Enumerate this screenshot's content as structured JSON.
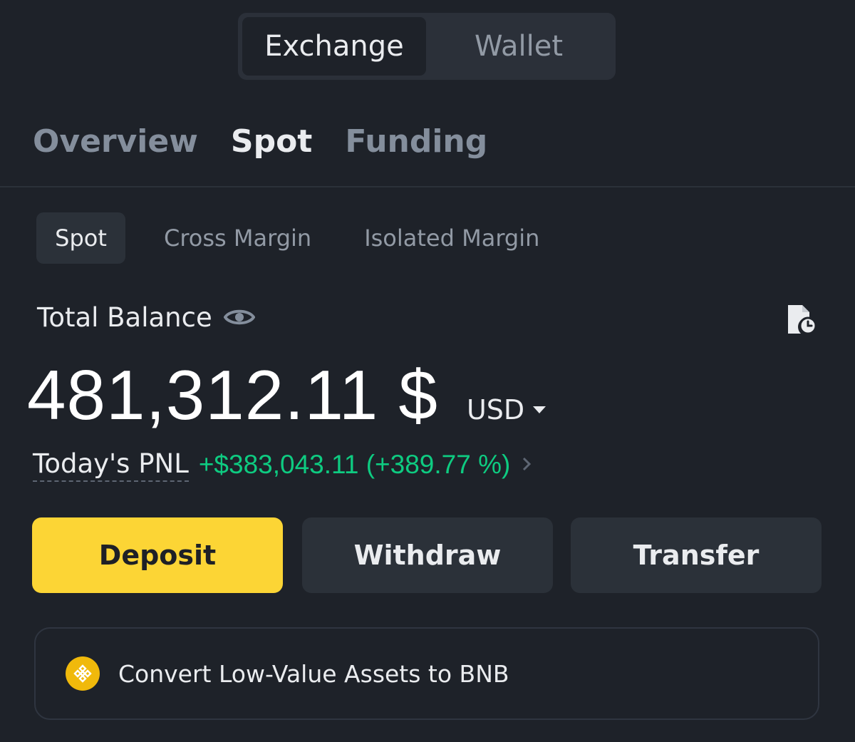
{
  "topSwitch": {
    "active": "Exchange",
    "inactive": "Wallet"
  },
  "mainTabs": [
    {
      "label": "Overview",
      "active": false
    },
    {
      "label": "Spot",
      "active": true
    },
    {
      "label": "Funding",
      "active": false
    }
  ],
  "subTabs": [
    {
      "label": "Spot",
      "active": true
    },
    {
      "label": "Cross Margin",
      "active": false
    },
    {
      "label": "Isolated Margin",
      "active": false
    }
  ],
  "balance": {
    "label": "Total Balance",
    "value": "481,312.11 $",
    "currency": "USD"
  },
  "pnl": {
    "label": "Today's PNL",
    "value": "+$383,043.11 (+389.77 %)"
  },
  "actions": {
    "deposit": "Deposit",
    "withdraw": "Withdraw",
    "transfer": "Transfer"
  },
  "convertBanner": {
    "text": "Convert Low-Value Assets to BNB"
  },
  "colors": {
    "background": "#1e2229",
    "accent": "#fcd535",
    "positive": "#0ecb81",
    "bnb": "#f0b90b"
  },
  "icons": {
    "visibility": "eye-icon",
    "history": "document-clock-icon",
    "pnlDetail": "chevron-right-icon",
    "currencyDropdown": "caret-down-icon",
    "bnb": "bnb-logo-icon"
  }
}
